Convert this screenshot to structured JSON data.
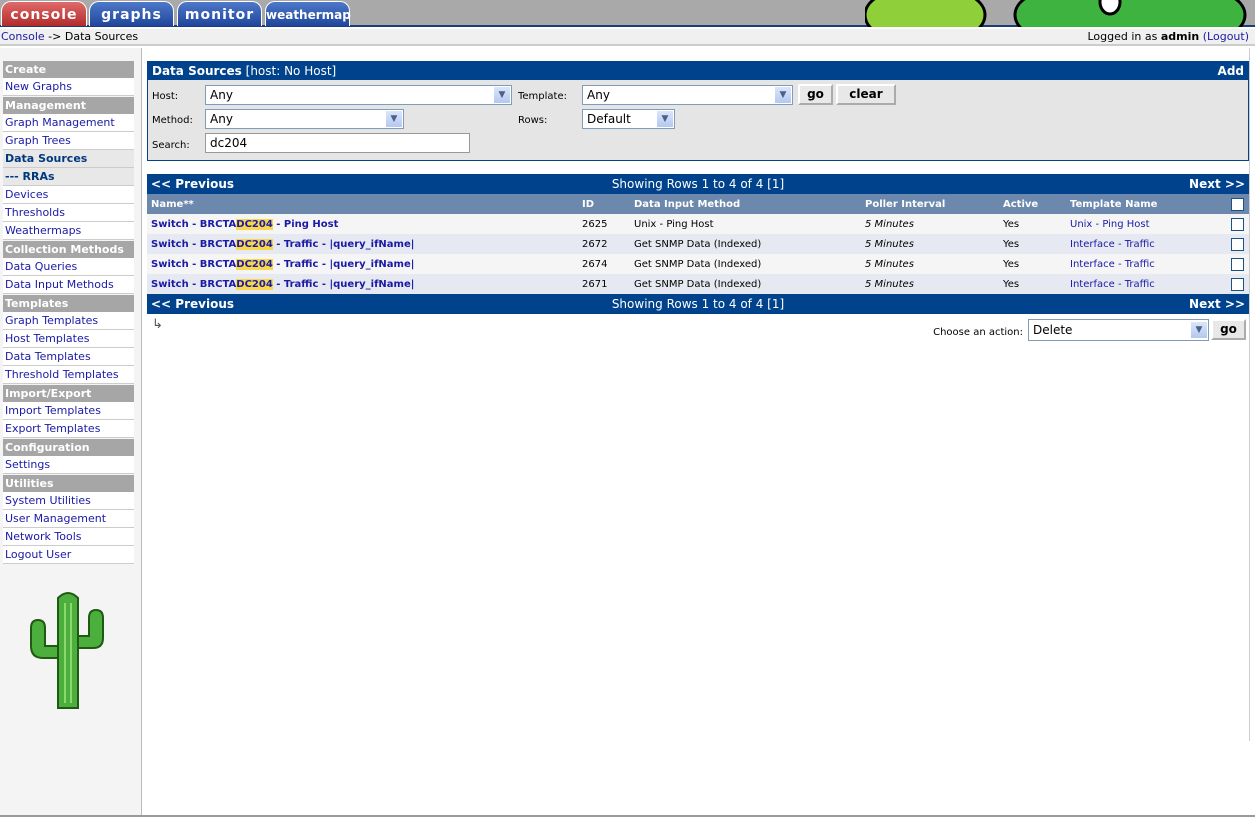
{
  "tabs": [
    {
      "label": "console",
      "active": true
    },
    {
      "label": "graphs"
    },
    {
      "label": "monitor"
    },
    {
      "label": "weathermap"
    }
  ],
  "breadcrumb": {
    "root": "Console",
    "separator": "->",
    "current": "Data Sources"
  },
  "login": {
    "prefix": "Logged in as",
    "user": "admin",
    "logout": "(Logout)"
  },
  "sidebar": [
    {
      "type": "head",
      "label": "Create"
    },
    {
      "type": "item",
      "label": "New Graphs"
    },
    {
      "type": "head",
      "label": "Management"
    },
    {
      "type": "item",
      "label": "Graph Management"
    },
    {
      "type": "item",
      "label": "Graph Trees"
    },
    {
      "type": "item",
      "label": "Data Sources",
      "active": true
    },
    {
      "type": "item",
      "label": "--- RRAs",
      "active": true
    },
    {
      "type": "item",
      "label": "Devices"
    },
    {
      "type": "item",
      "label": "Thresholds"
    },
    {
      "type": "item",
      "label": "Weathermaps"
    },
    {
      "type": "head",
      "label": "Collection Methods"
    },
    {
      "type": "item",
      "label": "Data Queries"
    },
    {
      "type": "item",
      "label": "Data Input Methods"
    },
    {
      "type": "head",
      "label": "Templates"
    },
    {
      "type": "item",
      "label": "Graph Templates"
    },
    {
      "type": "item",
      "label": "Host Templates"
    },
    {
      "type": "item",
      "label": "Data Templates"
    },
    {
      "type": "item",
      "label": "Threshold Templates"
    },
    {
      "type": "head",
      "label": "Import/Export"
    },
    {
      "type": "item",
      "label": "Import Templates"
    },
    {
      "type": "item",
      "label": "Export Templates"
    },
    {
      "type": "head",
      "label": "Configuration"
    },
    {
      "type": "item",
      "label": "Settings"
    },
    {
      "type": "head",
      "label": "Utilities"
    },
    {
      "type": "item",
      "label": "System Utilities"
    },
    {
      "type": "item",
      "label": "User Management"
    },
    {
      "type": "item",
      "label": "Network Tools"
    },
    {
      "type": "item",
      "label": "Logout User"
    }
  ],
  "filter": {
    "title": "Data Sources",
    "subtitle": "[host: No Host]",
    "add": "Add",
    "host_label": "Host:",
    "host_value": "Any",
    "template_label": "Template:",
    "template_value": "Any",
    "method_label": "Method:",
    "method_value": "Any",
    "rows_label": "Rows:",
    "rows_value": "Default",
    "search_label": "Search:",
    "search_value": "dc204",
    "go": "go",
    "clear": "clear"
  },
  "nav": {
    "prev": "<< Previous",
    "next": "Next >>",
    "showing": "Showing Rows 1 to 4 of 4 [1]"
  },
  "table": {
    "columns": [
      "Name**",
      "ID",
      "Data Input Method",
      "Poller Interval",
      "Active",
      "Template Name"
    ],
    "rows": [
      {
        "pre": "Switch - BRCTA",
        "hl": "DC204",
        "post": " - Ping Host",
        "id": "2625",
        "method": "Unix - Ping Host",
        "poller": "5 Minutes",
        "active": "Yes",
        "template": "Unix - Ping Host"
      },
      {
        "pre": "Switch - BRCTA",
        "hl": "DC204",
        "post": " - Traffic - |query_ifName|",
        "id": "2672",
        "method": "Get SNMP Data (Indexed)",
        "poller": "5 Minutes",
        "active": "Yes",
        "template": "Interface - Traffic"
      },
      {
        "pre": "Switch - BRCTA",
        "hl": "DC204",
        "post": " - Traffic - |query_ifName|",
        "id": "2674",
        "method": "Get SNMP Data (Indexed)",
        "poller": "5 Minutes",
        "active": "Yes",
        "template": "Interface - Traffic"
      },
      {
        "pre": "Switch - BRCTA",
        "hl": "DC204",
        "post": " - Traffic - |query_ifName|",
        "id": "2671",
        "method": "Get SNMP Data (Indexed)",
        "poller": "5 Minutes",
        "active": "Yes",
        "template": "Interface - Traffic"
      }
    ]
  },
  "action": {
    "label": "Choose an action:",
    "value": "Delete",
    "go": "go"
  }
}
